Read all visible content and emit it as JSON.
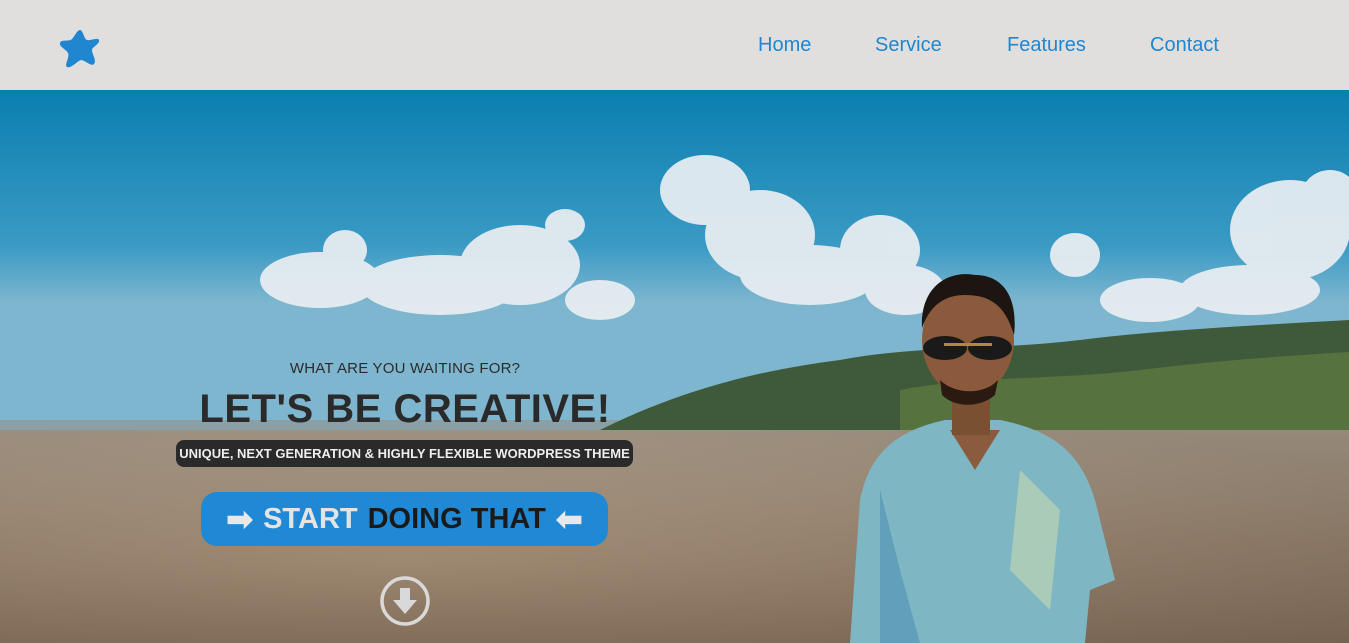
{
  "nav": {
    "logo_icon": "star-blob-icon",
    "links": [
      {
        "label": "Home"
      },
      {
        "label": "Service"
      },
      {
        "label": "Features"
      },
      {
        "label": "Contact"
      }
    ]
  },
  "hero": {
    "kicker": "WHAT ARE YOU WAITING FOR?",
    "headline": "LET'S BE CREATIVE!",
    "tagline": "UNIQUE, NEXT GENERATION & HIGHLY FLEXIBLE WORDPRESS THEME",
    "cta": {
      "arrow_left": "➡",
      "start": "START",
      "rest": "DOING THAT",
      "arrow_right": "⬅"
    },
    "scroll_icon": "arrow-down-circle-icon"
  },
  "colors": {
    "accent": "#1f86cf",
    "nav_bg": "#e0dfde",
    "text_dark": "#2a2a2a"
  }
}
